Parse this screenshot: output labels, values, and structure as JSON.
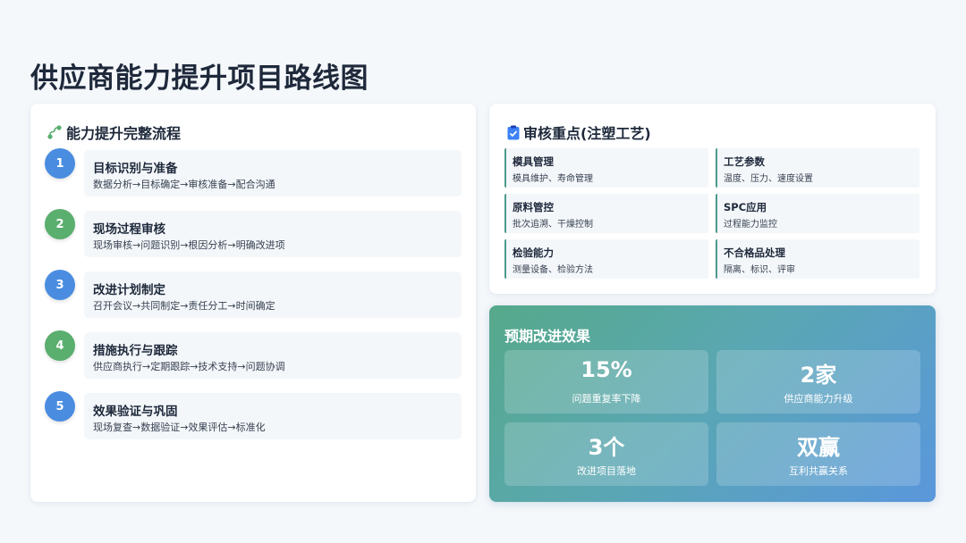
{
  "page": {
    "title": "供应商能力提升项目路线图"
  },
  "flow": {
    "heading": "能力提升完整流程",
    "steps": [
      {
        "num": "1",
        "title": "目标识别与准备",
        "desc": "数据分析→目标确定→审核准备→配合沟通",
        "color": "#4a8de0"
      },
      {
        "num": "2",
        "title": "现场过程审核",
        "desc": "现场审核→问题识别→根因分析→明确改进项",
        "color": "#5aae6e"
      },
      {
        "num": "3",
        "title": "改进计划制定",
        "desc": "召开会议→共同制定→责任分工→时间确定",
        "color": "#4a8de0"
      },
      {
        "num": "4",
        "title": "措施执行与跟踪",
        "desc": "供应商执行→定期跟踪→技术支持→问题协调",
        "color": "#5aae6e"
      },
      {
        "num": "5",
        "title": "效果验证与巩固",
        "desc": "现场复查→数据验证→效果评估→标准化",
        "color": "#4a8de0"
      }
    ]
  },
  "audit": {
    "heading": "审核重点(注塑工艺)",
    "items": [
      {
        "title": "模具管理",
        "desc": "模具维护、寿命管理"
      },
      {
        "title": "工艺参数",
        "desc": "温度、压力、速度设置"
      },
      {
        "title": "原料管控",
        "desc": "批次追溯、干燥控制"
      },
      {
        "title": "SPC应用",
        "desc": "过程能力监控"
      },
      {
        "title": "检验能力",
        "desc": "测量设备、检验方法"
      },
      {
        "title": "不合格品处理",
        "desc": "隔离、标识、评审"
      }
    ]
  },
  "effect": {
    "heading": "预期改进效果",
    "items": [
      {
        "value": "15%",
        "label": "问题重复率下降"
      },
      {
        "value": "2家",
        "label": "供应商能力升级"
      },
      {
        "value": "3个",
        "label": "改进项目落地"
      },
      {
        "value": "双赢",
        "label": "互利共赢关系"
      }
    ]
  }
}
